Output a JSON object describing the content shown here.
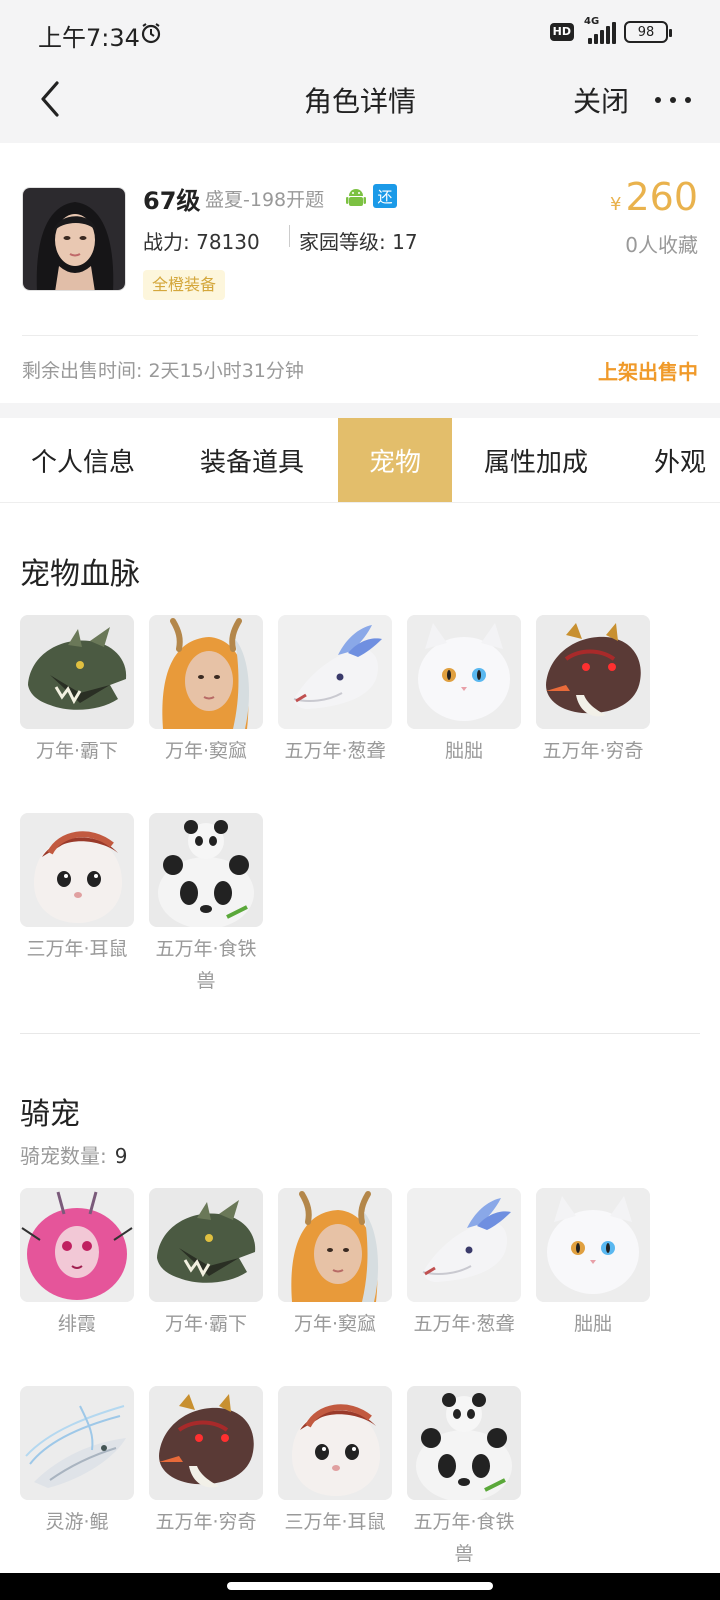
{
  "status_bar": {
    "time": "上午7:34",
    "hd": "HD",
    "network": "4G",
    "battery": "98"
  },
  "nav": {
    "title": "角色详情",
    "close_label": "关闭"
  },
  "role": {
    "level": "67级",
    "server": "盛夏-198开题",
    "return_badge": "还",
    "power": "战力: 78130",
    "home_level": "家园等级: 17",
    "equip_tag": "全橙装备",
    "price_symbol": "¥",
    "price": "260",
    "favorites": "0人收藏",
    "remaining_time": "剩余出售时间: 2天15小时31分钟",
    "sale_status": "上架出售中"
  },
  "tabs": [
    {
      "label": "个人信息",
      "active": false
    },
    {
      "label": "装备道具",
      "active": false
    },
    {
      "label": "宠物",
      "active": true
    },
    {
      "label": "属性加成",
      "active": false
    },
    {
      "label": "外观",
      "active": false
    }
  ],
  "pet_bloodline": {
    "title": "宠物血脉",
    "items": [
      {
        "name": "万年·霸下",
        "icon": "dragon-pet-icon"
      },
      {
        "name": "万年·窫窳",
        "icon": "fox-girl-pet-icon"
      },
      {
        "name": "五万年·葱聋",
        "icon": "white-wolf-pet-icon"
      },
      {
        "name": "朏朏",
        "icon": "white-cat-pet-icon"
      },
      {
        "name": "五万年·穷奇",
        "icon": "red-tiger-pet-icon"
      },
      {
        "name": "三万年·耳鼠",
        "icon": "mouse-pet-icon"
      },
      {
        "name": "五万年·食铁兽",
        "icon": "panda-pet-icon"
      }
    ]
  },
  "mounts": {
    "title": "骑宠",
    "count_label": "骑宠数量:",
    "count": "9",
    "items": [
      {
        "name": "绯霞",
        "icon": "pink-furball-pet-icon"
      },
      {
        "name": "万年·霸下",
        "icon": "dragon-pet-icon"
      },
      {
        "name": "万年·窫窳",
        "icon": "fox-girl-pet-icon"
      },
      {
        "name": "五万年·葱聋",
        "icon": "white-wolf-pet-icon"
      },
      {
        "name": "朏朏",
        "icon": "white-cat-pet-icon"
      },
      {
        "name": "灵游·鲲",
        "icon": "fish-pet-icon"
      },
      {
        "name": "五万年·穷奇",
        "icon": "red-tiger-pet-icon"
      },
      {
        "name": "三万年·耳鼠",
        "icon": "mouse-pet-icon"
      },
      {
        "name": "五万年·食铁兽",
        "icon": "panda-pet-icon"
      }
    ]
  },
  "colors": {
    "accent": "#e3be6b",
    "price": "#e9b24d",
    "sale_status": "#f09a2a",
    "badge_blue": "#1b9ae8"
  }
}
